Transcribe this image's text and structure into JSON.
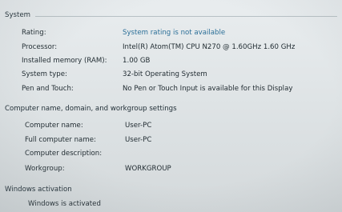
{
  "system": {
    "title": "System",
    "rows": [
      {
        "label": "Rating:",
        "value": "System rating is not available"
      },
      {
        "label": "Processor:",
        "value": "Intel(R) Atom(TM) CPU N270   @ 1.60GHz   1.60 GHz"
      },
      {
        "label": "Installed memory (RAM):",
        "value": "1.00 GB"
      },
      {
        "label": "System type:",
        "value": "32-bit Operating System"
      },
      {
        "label": "Pen and Touch:",
        "value": "No Pen or Touch Input is available for this Display"
      }
    ]
  },
  "computer_name": {
    "title": "Computer name, domain, and workgroup settings",
    "rows": [
      {
        "label": "Computer name:",
        "value": "User-PC"
      },
      {
        "label": "Full computer name:",
        "value": "User-PC"
      },
      {
        "label": "Computer description:",
        "value": ""
      },
      {
        "label": "Workgroup:",
        "value": "WORKGROUP"
      }
    ]
  },
  "activation": {
    "title": "Windows activation",
    "status": "Windows is activated"
  },
  "colors": {
    "link": "#2b6f98",
    "text": "#1f2a30",
    "rule": "#b7c0c4"
  }
}
